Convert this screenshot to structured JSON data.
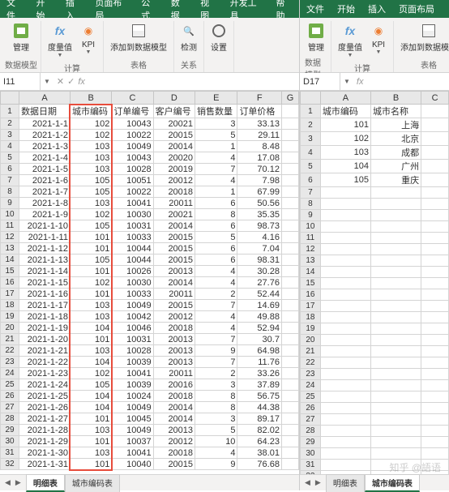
{
  "left": {
    "menu": [
      "文件",
      "开始",
      "插入",
      "页面布局",
      "公式",
      "数据",
      "视图",
      "开发工具",
      "帮助"
    ],
    "ribbon": {
      "groups": [
        {
          "label": "数据模型",
          "buttons": [
            {
              "label": "管理",
              "icon": "manage"
            }
          ]
        },
        {
          "label": "计算",
          "buttons": [
            {
              "label": "度量值",
              "icon": "fx",
              "dropdown": true
            },
            {
              "label": "KPI",
              "icon": "kpi",
              "dropdown": true
            }
          ]
        },
        {
          "label": "表格",
          "buttons": [
            {
              "label": "添加到数据模型",
              "icon": "table"
            }
          ]
        },
        {
          "label": "关系",
          "buttons": [
            {
              "label": "检测",
              "icon": "detect"
            }
          ]
        },
        {
          "label": "",
          "buttons": [
            {
              "label": "设置",
              "icon": "settings"
            }
          ]
        }
      ]
    },
    "name_box": "I11",
    "formula": "",
    "columns": [
      "A",
      "B",
      "C",
      "D",
      "E",
      "F",
      "G"
    ],
    "headers": [
      "数据日期",
      "城市编码",
      "订单编号",
      "客户编号",
      "销售数量",
      "订单价格"
    ],
    "highlight_column_index": 1,
    "rows": [
      [
        "2021-1-1",
        "102",
        "10043",
        "20021",
        "3",
        "33.13"
      ],
      [
        "2021-1-2",
        "102",
        "10022",
        "20015",
        "5",
        "29.11"
      ],
      [
        "2021-1-3",
        "103",
        "10049",
        "20014",
        "1",
        "8.48"
      ],
      [
        "2021-1-4",
        "103",
        "10043",
        "20020",
        "4",
        "17.08"
      ],
      [
        "2021-1-5",
        "103",
        "10028",
        "20019",
        "7",
        "70.12"
      ],
      [
        "2021-1-6",
        "105",
        "10051",
        "20012",
        "4",
        "7.98"
      ],
      [
        "2021-1-7",
        "105",
        "10022",
        "20018",
        "1",
        "67.99"
      ],
      [
        "2021-1-8",
        "103",
        "10041",
        "20011",
        "6",
        "50.56"
      ],
      [
        "2021-1-9",
        "102",
        "10030",
        "20021",
        "8",
        "35.35"
      ],
      [
        "2021-1-10",
        "105",
        "10031",
        "20014",
        "6",
        "98.73"
      ],
      [
        "2021-1-11",
        "101",
        "10033",
        "20015",
        "5",
        "4.16"
      ],
      [
        "2021-1-12",
        "101",
        "10044",
        "20015",
        "6",
        "7.04"
      ],
      [
        "2021-1-13",
        "105",
        "10044",
        "20015",
        "6",
        "98.31"
      ],
      [
        "2021-1-14",
        "101",
        "10026",
        "20013",
        "4",
        "30.28"
      ],
      [
        "2021-1-15",
        "102",
        "10030",
        "20014",
        "4",
        "27.76"
      ],
      [
        "2021-1-16",
        "101",
        "10033",
        "20011",
        "2",
        "52.44"
      ],
      [
        "2021-1-17",
        "103",
        "10049",
        "20015",
        "7",
        "14.69"
      ],
      [
        "2021-1-18",
        "103",
        "10042",
        "20012",
        "4",
        "49.88"
      ],
      [
        "2021-1-19",
        "104",
        "10046",
        "20018",
        "4",
        "52.94"
      ],
      [
        "2021-1-20",
        "101",
        "10031",
        "20013",
        "7",
        "30.7"
      ],
      [
        "2021-1-21",
        "103",
        "10028",
        "20013",
        "9",
        "64.98"
      ],
      [
        "2021-1-22",
        "104",
        "10039",
        "20013",
        "7",
        "11.76"
      ],
      [
        "2021-1-23",
        "102",
        "10041",
        "20011",
        "2",
        "33.26"
      ],
      [
        "2021-1-24",
        "105",
        "10039",
        "20016",
        "3",
        "37.89"
      ],
      [
        "2021-1-25",
        "104",
        "10024",
        "20018",
        "8",
        "56.75"
      ],
      [
        "2021-1-26",
        "104",
        "10049",
        "20014",
        "8",
        "44.38"
      ],
      [
        "2021-1-27",
        "101",
        "10045",
        "20014",
        "3",
        "89.17"
      ],
      [
        "2021-1-28",
        "103",
        "10049",
        "20013",
        "5",
        "82.02"
      ],
      [
        "2021-1-29",
        "101",
        "10037",
        "20012",
        "10",
        "64.23"
      ],
      [
        "2021-1-30",
        "103",
        "10041",
        "20018",
        "4",
        "38.01"
      ],
      [
        "2021-1-31",
        "101",
        "10040",
        "20015",
        "9",
        "76.68"
      ]
    ],
    "tabs": [
      {
        "label": "明细表",
        "active": true
      },
      {
        "label": "城市编码表",
        "active": false
      }
    ]
  },
  "right": {
    "menu": [
      "文件",
      "开始",
      "插入",
      "页面布局"
    ],
    "ribbon": {
      "groups": [
        {
          "label": "数据模型",
          "buttons": [
            {
              "label": "管理",
              "icon": "manage"
            }
          ]
        },
        {
          "label": "计算",
          "buttons": [
            {
              "label": "度量值",
              "icon": "fx",
              "dropdown": true
            },
            {
              "label": "KPI",
              "icon": "kpi",
              "dropdown": true
            }
          ]
        },
        {
          "label": "表格",
          "buttons": [
            {
              "label": "添加到数据模型",
              "icon": "table"
            }
          ]
        }
      ]
    },
    "name_box": "D17",
    "formula": "",
    "columns": [
      "A",
      "B",
      "C"
    ],
    "headers": [
      "城市编码",
      "城市名称"
    ],
    "rows": [
      [
        "101",
        "上海"
      ],
      [
        "102",
        "北京"
      ],
      [
        "103",
        "成都"
      ],
      [
        "104",
        "广州"
      ],
      [
        "105",
        "重庆"
      ]
    ],
    "empty_rows": 26,
    "tabs": [
      {
        "label": "明细表",
        "active": false
      },
      {
        "label": "城市编码表",
        "active": true
      }
    ]
  },
  "watermark": "知乎 @語语"
}
